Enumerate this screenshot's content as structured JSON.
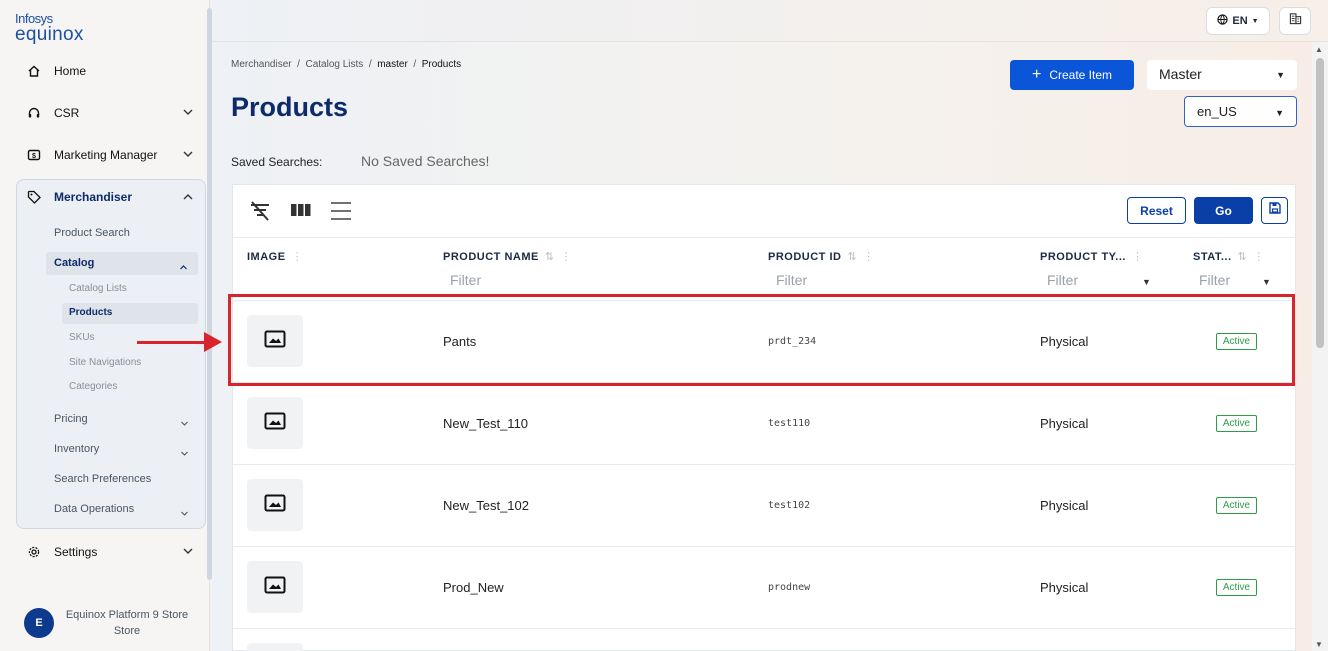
{
  "logo": {
    "line1": "Infosys",
    "line2": "equinox"
  },
  "sidebar": {
    "home": "Home",
    "csr": "CSR",
    "marketing": "Marketing Manager",
    "merchandiser": "Merchandiser",
    "product_search": "Product Search",
    "catalog": "Catalog",
    "catalog_lists": "Catalog Lists",
    "products": "Products",
    "skus": "SKUs",
    "site_navigations": "Site Navigations",
    "categories": "Categories",
    "pricing": "Pricing",
    "inventory": "Inventory",
    "search_preferences": "Search Preferences",
    "data_operations": "Data Operations",
    "settings": "Settings"
  },
  "user": {
    "initial": "E",
    "name": "Equinox Platform 9 Store Store"
  },
  "topbar": {
    "lang": "EN"
  },
  "breadcrumb": {
    "b1": "Merchandiser",
    "b2": "Catalog Lists",
    "b3": "master",
    "b4": "Products",
    "sep": "/"
  },
  "page": {
    "title": "Products",
    "saved_label": "Saved Searches:",
    "saved_value": "No Saved Searches!"
  },
  "actions": {
    "create": "Create Item",
    "master": "Master",
    "locale": "en_US",
    "reset": "Reset",
    "go": "Go"
  },
  "table": {
    "headers": {
      "image": "IMAGE",
      "name": "PRODUCT NAME",
      "id": "PRODUCT ID",
      "type": "PRODUCT TY...",
      "status": "STAT..."
    },
    "filter_placeholder": "Filter",
    "rows": [
      {
        "name": "Pants",
        "id": "prdt_234",
        "type": "Physical",
        "status": "Active"
      },
      {
        "name": "New_Test_110",
        "id": "test110",
        "type": "Physical",
        "status": "Active"
      },
      {
        "name": "New_Test_102",
        "id": "test102",
        "type": "Physical",
        "status": "Active"
      },
      {
        "name": "Prod_New",
        "id": "prodnew",
        "type": "Physical",
        "status": "Active"
      }
    ]
  },
  "colors": {
    "brand": "#0d2b6b",
    "primary": "#0a55d8",
    "highlight": "#d7252b",
    "status": "#2e9c48"
  }
}
